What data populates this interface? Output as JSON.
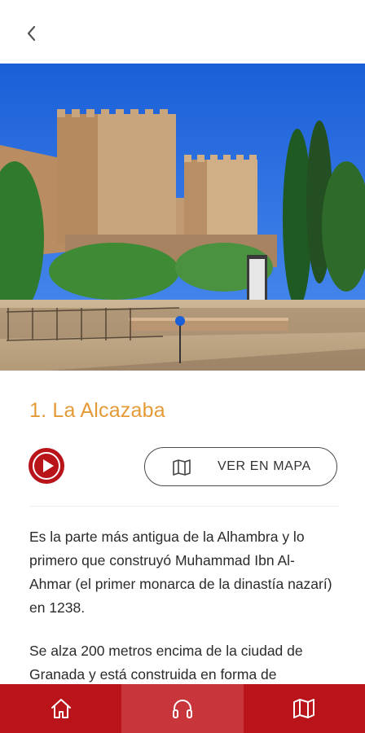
{
  "header": {
    "back_icon": "chevron-left-icon"
  },
  "hero": {
    "description_alt": "La Alcazaba"
  },
  "content": {
    "title": "1. La Alcazaba",
    "play_icon": "play-icon",
    "map_button_label": "VER EN MAPA",
    "map_button_icon": "map-icon",
    "paragraphs": [
      "Es la parte más antigua de la Alhambra y lo primero que construyó Muhammad Ibn Al-Ahmar (el primer monarca de la dinastía nazarí) en 1238.",
      "Se alza 200 metros encima de la ciudad de Granada y está construida en forma de"
    ]
  },
  "bottom_nav": {
    "items": [
      {
        "icon": "home-icon",
        "active": false
      },
      {
        "icon": "headphones-icon",
        "active": true
      },
      {
        "icon": "map-icon",
        "active": false
      }
    ]
  },
  "colors": {
    "brand_red": "#b8141a",
    "active_tab": "#c8363c",
    "title_orange": "#e59a37"
  }
}
